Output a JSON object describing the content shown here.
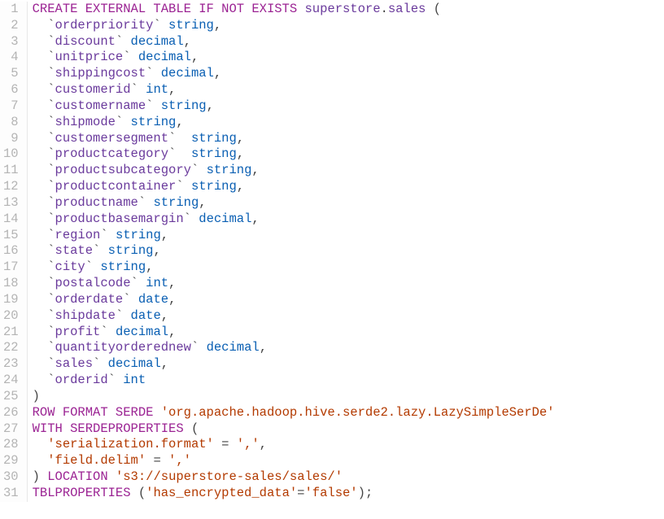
{
  "editor": {
    "lineCount": 31,
    "lines": [
      {
        "n": 1,
        "tokens": [
          {
            "t": "CREATE EXTERNAL TABLE IF NOT EXISTS",
            "c": "kw"
          },
          {
            "t": " ",
            "c": "plain"
          },
          {
            "t": "superstore",
            "c": "ident"
          },
          {
            "t": ".",
            "c": "punct"
          },
          {
            "t": "sales",
            "c": "ident"
          },
          {
            "t": " (",
            "c": "punct"
          }
        ]
      },
      {
        "n": 2,
        "tokens": [
          {
            "t": "  `",
            "c": "punct"
          },
          {
            "t": "orderpriority",
            "c": "ident"
          },
          {
            "t": "` ",
            "c": "punct"
          },
          {
            "t": "string",
            "c": "type"
          },
          {
            "t": ",",
            "c": "punct"
          }
        ]
      },
      {
        "n": 3,
        "tokens": [
          {
            "t": "  `",
            "c": "punct"
          },
          {
            "t": "discount",
            "c": "ident"
          },
          {
            "t": "` ",
            "c": "punct"
          },
          {
            "t": "decimal",
            "c": "type"
          },
          {
            "t": ",",
            "c": "punct"
          }
        ]
      },
      {
        "n": 4,
        "tokens": [
          {
            "t": "  `",
            "c": "punct"
          },
          {
            "t": "unitprice",
            "c": "ident"
          },
          {
            "t": "` ",
            "c": "punct"
          },
          {
            "t": "decimal",
            "c": "type"
          },
          {
            "t": ",",
            "c": "punct"
          }
        ]
      },
      {
        "n": 5,
        "tokens": [
          {
            "t": "  `",
            "c": "punct"
          },
          {
            "t": "shippingcost",
            "c": "ident"
          },
          {
            "t": "` ",
            "c": "punct"
          },
          {
            "t": "decimal",
            "c": "type"
          },
          {
            "t": ",",
            "c": "punct"
          }
        ]
      },
      {
        "n": 6,
        "tokens": [
          {
            "t": "  `",
            "c": "punct"
          },
          {
            "t": "customerid",
            "c": "ident"
          },
          {
            "t": "` ",
            "c": "punct"
          },
          {
            "t": "int",
            "c": "type"
          },
          {
            "t": ",",
            "c": "punct"
          }
        ]
      },
      {
        "n": 7,
        "tokens": [
          {
            "t": "  `",
            "c": "punct"
          },
          {
            "t": "customername",
            "c": "ident"
          },
          {
            "t": "` ",
            "c": "punct"
          },
          {
            "t": "string",
            "c": "type"
          },
          {
            "t": ",",
            "c": "punct"
          }
        ]
      },
      {
        "n": 8,
        "tokens": [
          {
            "t": "  `",
            "c": "punct"
          },
          {
            "t": "shipmode",
            "c": "ident"
          },
          {
            "t": "` ",
            "c": "punct"
          },
          {
            "t": "string",
            "c": "type"
          },
          {
            "t": ",",
            "c": "punct"
          }
        ]
      },
      {
        "n": 9,
        "tokens": [
          {
            "t": "  `",
            "c": "punct"
          },
          {
            "t": "customersegment",
            "c": "ident"
          },
          {
            "t": "`  ",
            "c": "punct"
          },
          {
            "t": "string",
            "c": "type"
          },
          {
            "t": ",",
            "c": "punct"
          }
        ]
      },
      {
        "n": 10,
        "tokens": [
          {
            "t": "  `",
            "c": "punct"
          },
          {
            "t": "productcategory",
            "c": "ident"
          },
          {
            "t": "`  ",
            "c": "punct"
          },
          {
            "t": "string",
            "c": "type"
          },
          {
            "t": ",",
            "c": "punct"
          }
        ]
      },
      {
        "n": 11,
        "tokens": [
          {
            "t": "  `",
            "c": "punct"
          },
          {
            "t": "productsubcategory",
            "c": "ident"
          },
          {
            "t": "` ",
            "c": "punct"
          },
          {
            "t": "string",
            "c": "type"
          },
          {
            "t": ",",
            "c": "punct"
          }
        ]
      },
      {
        "n": 12,
        "tokens": [
          {
            "t": "  `",
            "c": "punct"
          },
          {
            "t": "productcontainer",
            "c": "ident"
          },
          {
            "t": "` ",
            "c": "punct"
          },
          {
            "t": "string",
            "c": "type"
          },
          {
            "t": ",",
            "c": "punct"
          }
        ]
      },
      {
        "n": 13,
        "tokens": [
          {
            "t": "  `",
            "c": "punct"
          },
          {
            "t": "productname",
            "c": "ident"
          },
          {
            "t": "` ",
            "c": "punct"
          },
          {
            "t": "string",
            "c": "type"
          },
          {
            "t": ",",
            "c": "punct"
          }
        ]
      },
      {
        "n": 14,
        "tokens": [
          {
            "t": "  `",
            "c": "punct"
          },
          {
            "t": "productbasemargin",
            "c": "ident"
          },
          {
            "t": "` ",
            "c": "punct"
          },
          {
            "t": "decimal",
            "c": "type"
          },
          {
            "t": ",",
            "c": "punct"
          }
        ]
      },
      {
        "n": 15,
        "tokens": [
          {
            "t": "  `",
            "c": "punct"
          },
          {
            "t": "region",
            "c": "ident"
          },
          {
            "t": "` ",
            "c": "punct"
          },
          {
            "t": "string",
            "c": "type"
          },
          {
            "t": ",",
            "c": "punct"
          }
        ]
      },
      {
        "n": 16,
        "tokens": [
          {
            "t": "  `",
            "c": "punct"
          },
          {
            "t": "state",
            "c": "ident"
          },
          {
            "t": "` ",
            "c": "punct"
          },
          {
            "t": "string",
            "c": "type"
          },
          {
            "t": ",",
            "c": "punct"
          }
        ]
      },
      {
        "n": 17,
        "tokens": [
          {
            "t": "  `",
            "c": "punct"
          },
          {
            "t": "city",
            "c": "ident"
          },
          {
            "t": "` ",
            "c": "punct"
          },
          {
            "t": "string",
            "c": "type"
          },
          {
            "t": ",",
            "c": "punct"
          }
        ]
      },
      {
        "n": 18,
        "tokens": [
          {
            "t": "  `",
            "c": "punct"
          },
          {
            "t": "postalcode",
            "c": "ident"
          },
          {
            "t": "` ",
            "c": "punct"
          },
          {
            "t": "int",
            "c": "type"
          },
          {
            "t": ",",
            "c": "punct"
          }
        ]
      },
      {
        "n": 19,
        "tokens": [
          {
            "t": "  `",
            "c": "punct"
          },
          {
            "t": "orderdate",
            "c": "ident"
          },
          {
            "t": "` ",
            "c": "punct"
          },
          {
            "t": "date",
            "c": "type"
          },
          {
            "t": ",",
            "c": "punct"
          }
        ]
      },
      {
        "n": 20,
        "tokens": [
          {
            "t": "  `",
            "c": "punct"
          },
          {
            "t": "shipdate",
            "c": "ident"
          },
          {
            "t": "` ",
            "c": "punct"
          },
          {
            "t": "date",
            "c": "type"
          },
          {
            "t": ",",
            "c": "punct"
          }
        ]
      },
      {
        "n": 21,
        "tokens": [
          {
            "t": "  `",
            "c": "punct"
          },
          {
            "t": "profit",
            "c": "ident"
          },
          {
            "t": "` ",
            "c": "punct"
          },
          {
            "t": "decimal",
            "c": "type"
          },
          {
            "t": ",",
            "c": "punct"
          }
        ]
      },
      {
        "n": 22,
        "tokens": [
          {
            "t": "  `",
            "c": "punct"
          },
          {
            "t": "quantityorderednew",
            "c": "ident"
          },
          {
            "t": "` ",
            "c": "punct"
          },
          {
            "t": "decimal",
            "c": "type"
          },
          {
            "t": ",",
            "c": "punct"
          }
        ]
      },
      {
        "n": 23,
        "tokens": [
          {
            "t": "  `",
            "c": "punct"
          },
          {
            "t": "sales",
            "c": "ident"
          },
          {
            "t": "` ",
            "c": "punct"
          },
          {
            "t": "decimal",
            "c": "type"
          },
          {
            "t": ",",
            "c": "punct"
          }
        ]
      },
      {
        "n": 24,
        "tokens": [
          {
            "t": "  `",
            "c": "punct"
          },
          {
            "t": "orderid",
            "c": "ident"
          },
          {
            "t": "` ",
            "c": "punct"
          },
          {
            "t": "int",
            "c": "type"
          }
        ]
      },
      {
        "n": 25,
        "tokens": [
          {
            "t": ")",
            "c": "punct"
          }
        ]
      },
      {
        "n": 26,
        "tokens": [
          {
            "t": "ROW FORMAT SERDE",
            "c": "kw"
          },
          {
            "t": " ",
            "c": "plain"
          },
          {
            "t": "'org.apache.hadoop.hive.serde2.lazy.LazySimpleSerDe'",
            "c": "str"
          }
        ]
      },
      {
        "n": 27,
        "tokens": [
          {
            "t": "WITH SERDEPROPERTIES",
            "c": "kw"
          },
          {
            "t": " (",
            "c": "punct"
          }
        ]
      },
      {
        "n": 28,
        "tokens": [
          {
            "t": "  ",
            "c": "plain"
          },
          {
            "t": "'serialization.format'",
            "c": "str"
          },
          {
            "t": " = ",
            "c": "punct"
          },
          {
            "t": "','",
            "c": "str"
          },
          {
            "t": ",",
            "c": "punct"
          }
        ]
      },
      {
        "n": 29,
        "tokens": [
          {
            "t": "  ",
            "c": "plain"
          },
          {
            "t": "'field.delim'",
            "c": "str"
          },
          {
            "t": " = ",
            "c": "punct"
          },
          {
            "t": "','",
            "c": "str"
          }
        ]
      },
      {
        "n": 30,
        "tokens": [
          {
            "t": ") ",
            "c": "punct"
          },
          {
            "t": "LOCATION",
            "c": "kw"
          },
          {
            "t": " ",
            "c": "plain"
          },
          {
            "t": "'s3://superstore-sales/sales/'",
            "c": "str"
          }
        ]
      },
      {
        "n": 31,
        "tokens": [
          {
            "t": "TBLPROPERTIES",
            "c": "kw"
          },
          {
            "t": " (",
            "c": "punct"
          },
          {
            "t": "'has_encrypted_data'",
            "c": "str"
          },
          {
            "t": "=",
            "c": "punct"
          },
          {
            "t": "'false'",
            "c": "str"
          },
          {
            "t": ");",
            "c": "punct"
          }
        ]
      }
    ]
  }
}
